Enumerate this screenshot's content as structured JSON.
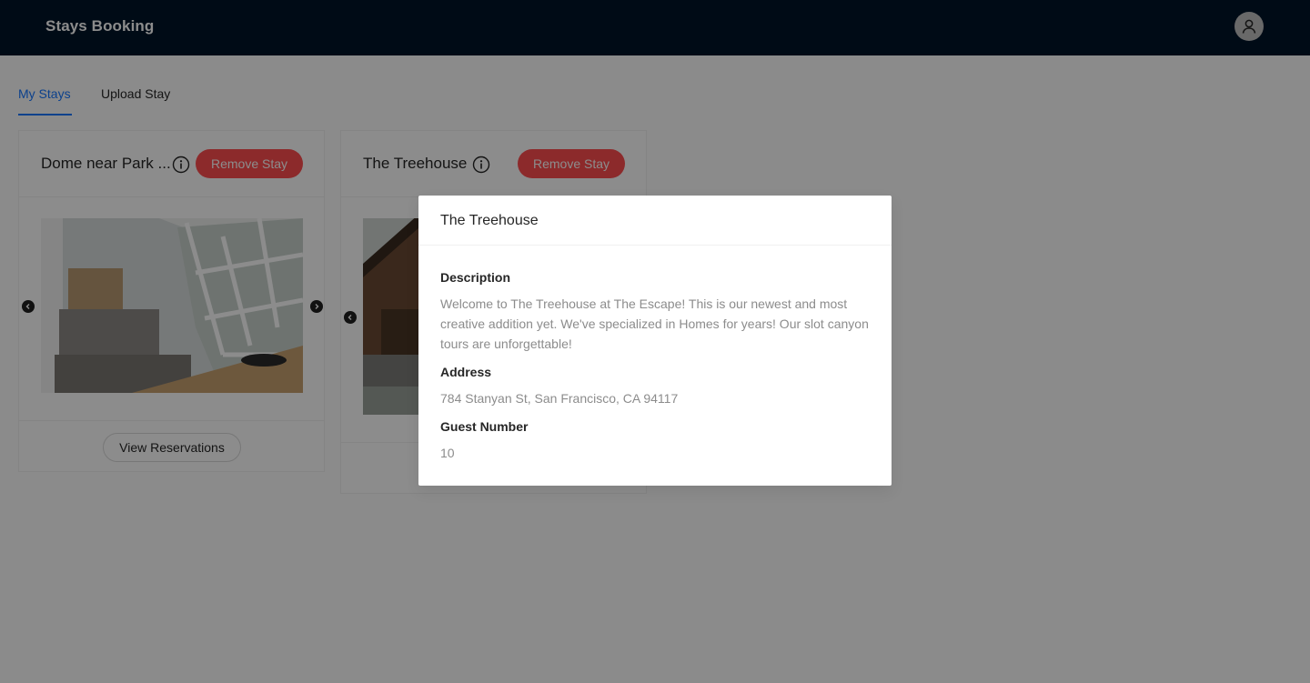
{
  "header": {
    "app_title": "Stays Booking",
    "avatar_icon": "user-icon"
  },
  "tabs": [
    {
      "label": "My Stays",
      "active": true
    },
    {
      "label": "Upload Stay",
      "active": false
    }
  ],
  "stays": [
    {
      "title": "Dome near Park ...",
      "remove_label": "Remove Stay",
      "view_label": "View Reservations",
      "info_icon": "info-circle-icon"
    },
    {
      "title": "The Treehouse",
      "remove_label": "Remove Stay",
      "info_icon": "info-circle-icon"
    }
  ],
  "modal": {
    "title": "The Treehouse",
    "description_label": "Description",
    "description": "Welcome to The Treehouse at The Escape! This is our newest and most creative addition yet. We've specialized in Homes for years! Our slot canyon tours are unforgettable!",
    "address_label": "Address",
    "address": "784 Stanyan St, San Francisco, CA 94117",
    "guest_label": "Guest Number",
    "guest_number": "10"
  },
  "colors": {
    "header_bg": "#001529",
    "accent": "#1677ff",
    "danger": "#ff4d4f"
  }
}
